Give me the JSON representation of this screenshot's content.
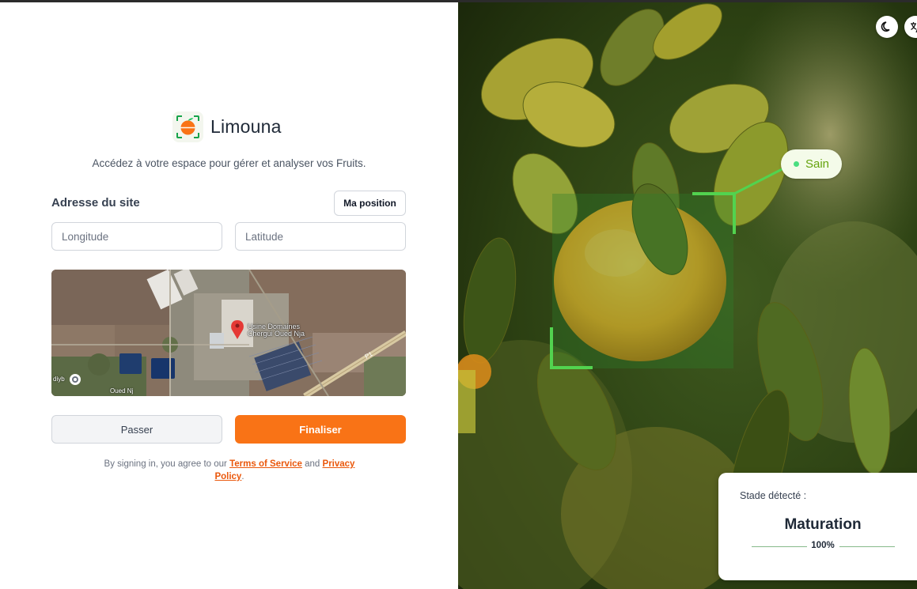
{
  "brand": {
    "name": "Limouna"
  },
  "subtitle": "Accédez à votre espace pour gérer et analyser vos Fruits.",
  "site": {
    "label": "Adresse du site",
    "position_button": "Ma position",
    "longitude": {
      "value": "",
      "placeholder": "Longitude"
    },
    "latitude": {
      "value": "",
      "placeholder": "Latitude"
    }
  },
  "map": {
    "marker_label": "Usine Domaines Chergui Oued Nja",
    "road_label": "Oued Nj",
    "edge_label": "diyb",
    "road_code": "P1"
  },
  "actions": {
    "skip": "Passer",
    "finish": "Finaliser"
  },
  "terms": {
    "prefix": "By signing in, you agree to our",
    "tos": "Terms of Service",
    "and": "and",
    "privacy": "Privacy Policy",
    "suffix": "."
  },
  "detection": {
    "health_badge": "Sain",
    "stage_label": "Stade détecté :",
    "stage_value": "Maturation",
    "confidence": "100%"
  },
  "colors": {
    "accent": "#f97316",
    "link": "#ea580c",
    "healthy": "#4ade80",
    "detection_box": "#22c55e"
  },
  "icons": {
    "theme_toggle": "moon-icon",
    "language": "translate-icon",
    "map_marker": "map-pin-icon"
  }
}
